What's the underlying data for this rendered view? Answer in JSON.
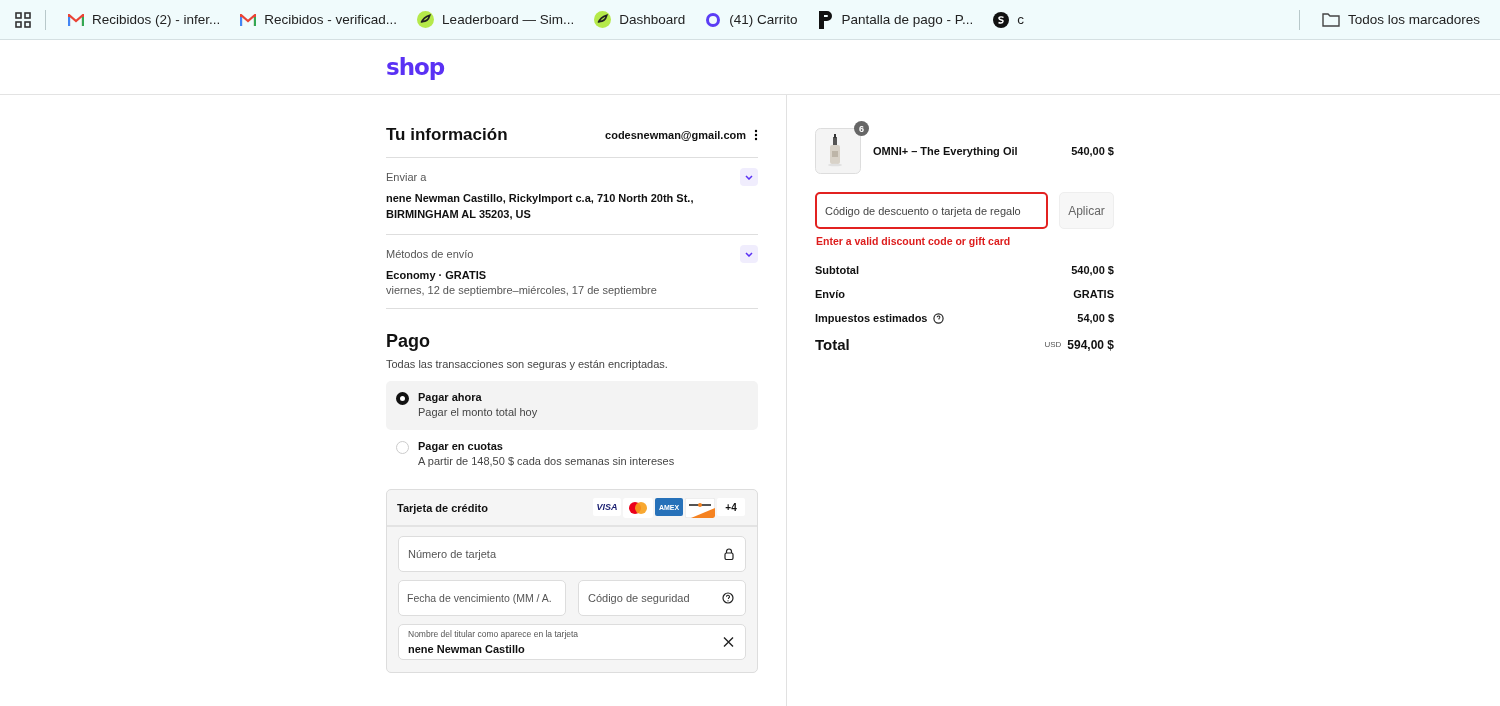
{
  "bookmarks_bar": {
    "items": [
      {
        "label": "Recibidos (2) - infer...",
        "kind": "gmail"
      },
      {
        "label": "Recibidos - verificad...",
        "kind": "gmail"
      },
      {
        "label": "Leaderboard — Sim...",
        "kind": "leaf"
      },
      {
        "label": "Dashboard",
        "kind": "leaf"
      },
      {
        "label": "(41) Carrito",
        "kind": "ring"
      },
      {
        "label": "Pantalla de pago - P...",
        "kind": "p"
      },
      {
        "label": "c",
        "kind": "s"
      }
    ],
    "folder": "Todos los marcadores"
  },
  "header": {
    "logo": "shop"
  },
  "info": {
    "title": "Tu información",
    "email": "codesnewman@gmail.com",
    "sections": [
      {
        "label": "Enviar a",
        "value": "nene Newman Castillo, RickyImport c.a, 710 North 20th St., BIRMINGHAM AL 35203, US"
      },
      {
        "label": "Métodos de envío",
        "value": "Economy · GRATIS",
        "detail": "viernes, 12 de septiembre–miércoles, 17 de septiembre"
      }
    ]
  },
  "payment": {
    "title": "Pago",
    "subtitle": "Todas las transacciones son seguras y están encriptadas.",
    "options": [
      {
        "label": "Pagar ahora",
        "detail": "Pagar el monto total hoy",
        "selected": true
      },
      {
        "label": "Pagar en cuotas",
        "detail": "A partir de 148,50 $ cada dos semanas sin intereses",
        "selected": false
      }
    ],
    "card": {
      "title": "Tarjeta de crédito",
      "brands": [
        {
          "kind": "visa",
          "label": "VISA"
        },
        {
          "kind": "mastercard"
        },
        {
          "kind": "amex",
          "label": "AMEX"
        },
        {
          "kind": "discover"
        },
        {
          "kind": "more",
          "label": "+4"
        }
      ],
      "number": {
        "placeholder": "Número de tarjeta"
      },
      "expiry": {
        "placeholder": "Fecha de vencimiento (MM / A."
      },
      "security": {
        "placeholder": "Código de seguridad"
      },
      "holder": {
        "label": "Nombre del titular como aparece en la tarjeta",
        "value": "nene Newman Castillo"
      }
    }
  },
  "summary": {
    "product": {
      "name": "OMNI+ – The Everything Oil",
      "price": "540,00 $",
      "quantity": "6"
    },
    "discount": {
      "placeholder": "Código de descuento o tarjeta de regalo",
      "button": "Aplicar",
      "error": "Enter a valid discount code or gift card"
    },
    "lines": [
      {
        "label": "Subtotal",
        "value": "540,00 $"
      },
      {
        "label": "Envío",
        "value": "GRATIS"
      },
      {
        "label": "Impuestos estimados",
        "value": "54,00 $",
        "info": true
      }
    ],
    "total": {
      "label": "Total",
      "currency": "USD",
      "value": "594,00 $"
    }
  }
}
